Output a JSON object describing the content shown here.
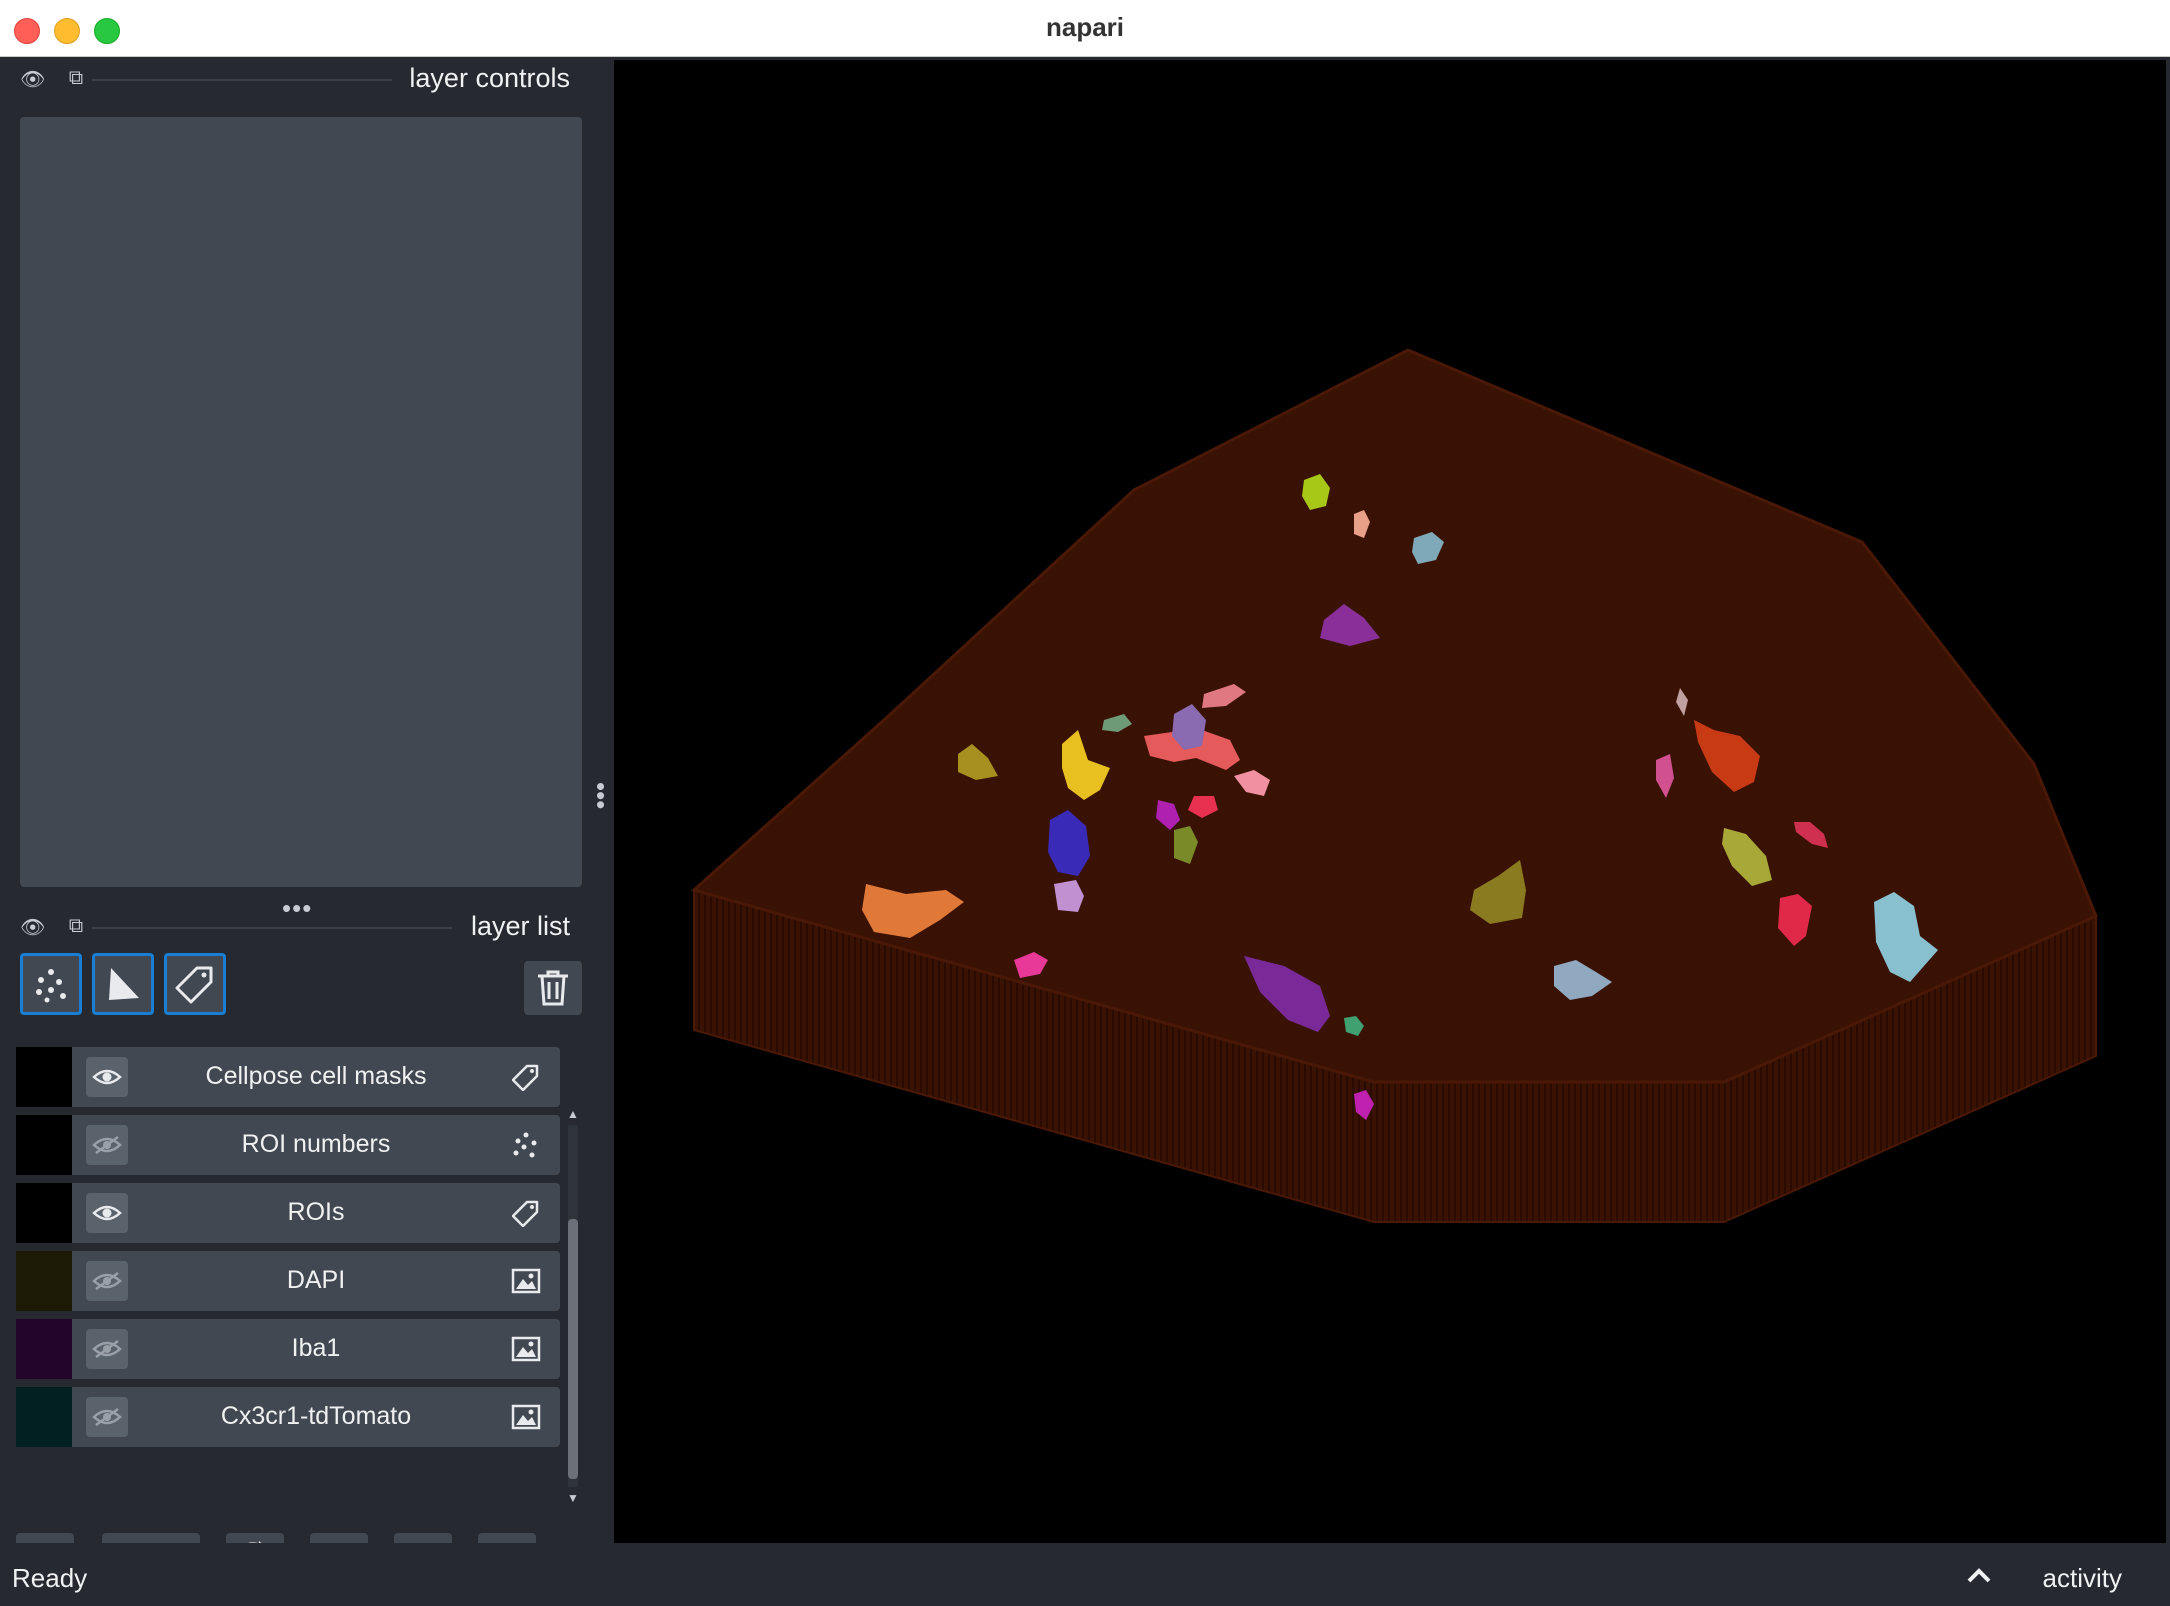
{
  "window": {
    "title": "napari"
  },
  "layer_controls": {
    "title": "layer controls"
  },
  "layer_list": {
    "title": "layer list",
    "layers": [
      {
        "name": "Cellpose cell masks",
        "type_icon": "label-tag-icon",
        "visible": true,
        "thumb": "#000000"
      },
      {
        "name": "ROI numbers",
        "type_icon": "points-icon",
        "visible": false,
        "thumb": "#000000"
      },
      {
        "name": "ROIs",
        "type_icon": "label-tag-icon",
        "visible": true,
        "thumb": "#000000"
      },
      {
        "name": "DAPI",
        "type_icon": "image-icon",
        "visible": false,
        "thumb": "#1c1a05"
      },
      {
        "name": "Iba1",
        "type_icon": "image-icon",
        "visible": false,
        "thumb": "#24052a"
      },
      {
        "name": "Cx3cr1-tdTomato",
        "type_icon": "image-icon",
        "visible": false,
        "thumb": "#022022"
      }
    ]
  },
  "layer_buttons": [
    "new-points-icon",
    "new-shapes-icon",
    "new-labels-icon",
    "delete-layer-icon"
  ],
  "viewer_buttons": [
    "console-icon",
    "ndisplay-toggle-icon",
    "roll-dims-icon",
    "transpose-dims-icon",
    "grid-view-icon",
    "home-icon"
  ],
  "status": {
    "text": "Ready",
    "activity_label": "activity"
  },
  "colors": {
    "accent": "#1a7fd4",
    "background": "#262930",
    "panel": "#414851",
    "volume": "#3a1204"
  }
}
